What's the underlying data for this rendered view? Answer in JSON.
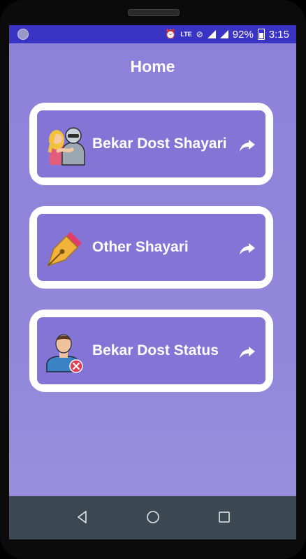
{
  "status": {
    "battery_percent": "92%",
    "time": "3:15",
    "network": "LTE"
  },
  "page": {
    "title": "Home"
  },
  "cards": [
    {
      "label": "Bekar Dost Shayari",
      "icon": "friends-icon"
    },
    {
      "label": "Other Shayari",
      "icon": "pen-nib-icon"
    },
    {
      "label": "Bekar Dost Status",
      "icon": "user-remove-icon"
    }
  ],
  "nav": {
    "back": "back-icon",
    "home": "home-icon",
    "recents": "recents-icon"
  },
  "colors": {
    "status_bar": "#3a34c4",
    "background": "#8d80d9",
    "card_fill": "#8474d6",
    "nav_bar": "#3b4851"
  }
}
